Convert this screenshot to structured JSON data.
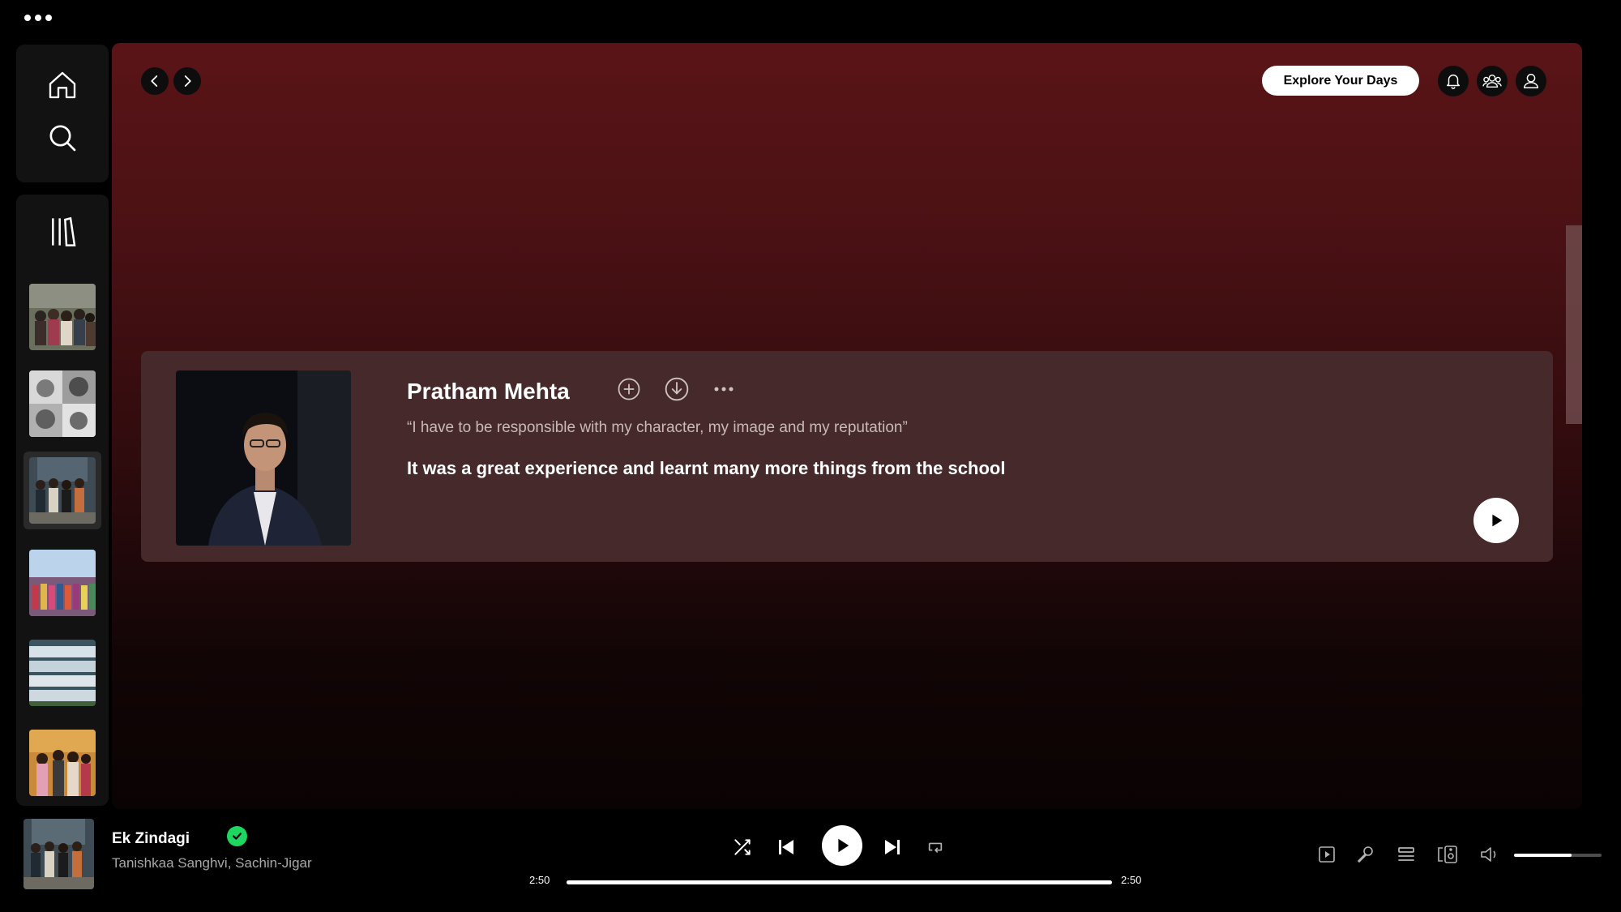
{
  "header": {
    "explore_label": "Explore Your Days"
  },
  "card": {
    "name": "Pratham Mehta",
    "quote": "“I have to be responsible with my character, my image and my reputation”",
    "text": "It was a great experience and learnt many more things from the school"
  },
  "now_playing": {
    "title": "Ek Zindagi",
    "artist": "Tanishkaa Sanghvi, Sachin-Jigar",
    "elapsed": "2:50",
    "duration": "2:50",
    "progress_fraction": 1.0,
    "volume_fraction": 0.66
  },
  "icons": {
    "home": "home-icon",
    "search": "search-icon",
    "library": "library-icon",
    "back": "chevron-left-icon",
    "forward": "chevron-right-icon",
    "bell": "bell-icon",
    "friends": "friends-icon",
    "profile": "user-icon",
    "add": "plus-circle-icon",
    "download": "download-icon",
    "more": "more-icon",
    "shuffle": "shuffle-icon",
    "previous": "skip-back-icon",
    "play": "play-icon",
    "next": "skip-forward-icon",
    "repeat": "repeat-icon",
    "now_playing_view": "now-playing-view-icon",
    "lyrics": "microphone-icon",
    "queue": "queue-icon",
    "connect": "connect-device-icon",
    "volume": "volume-icon"
  },
  "colors": {
    "accent_green": "#1ed760",
    "main_top": "#5a1417",
    "card_bg": "#462a2b"
  }
}
